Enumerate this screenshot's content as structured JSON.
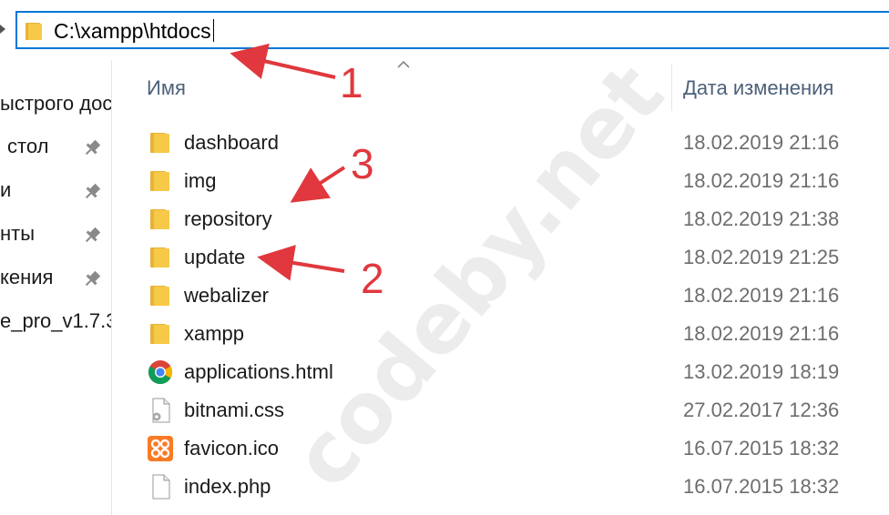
{
  "address_bar": {
    "path": "C:\\xampp\\htdocs"
  },
  "sidebar": {
    "items": [
      {
        "label": "ыстрого дос",
        "pinned": false
      },
      {
        "label": "стол",
        "pinned": true
      },
      {
        "label": "и",
        "pinned": true
      },
      {
        "label": "нты",
        "pinned": true
      },
      {
        "label": "кения",
        "pinned": true
      },
      {
        "label": "e_pro_v1.7.3",
        "pinned": false
      }
    ]
  },
  "columns": {
    "name": "Имя",
    "date_modified": "Дата изменения"
  },
  "files": [
    {
      "name": "dashboard",
      "date": "18.02.2019 21:16",
      "icon": "folder-icon"
    },
    {
      "name": "img",
      "date": "18.02.2019 21:16",
      "icon": "folder-icon"
    },
    {
      "name": "repository",
      "date": "18.02.2019 21:38",
      "icon": "folder-icon"
    },
    {
      "name": "update",
      "date": "18.02.2019 21:25",
      "icon": "folder-icon"
    },
    {
      "name": "webalizer",
      "date": "18.02.2019 21:16",
      "icon": "folder-icon"
    },
    {
      "name": "xampp",
      "date": "18.02.2019 21:16",
      "icon": "folder-icon"
    },
    {
      "name": "applications.html",
      "date": "13.02.2019 18:19",
      "icon": "chrome-icon"
    },
    {
      "name": "bitnami.css",
      "date": "27.02.2017 12:36",
      "icon": "css-file-icon"
    },
    {
      "name": "favicon.ico",
      "date": "16.07.2015 18:32",
      "icon": "xampp-icon"
    },
    {
      "name": "index.php",
      "date": "16.07.2015 18:32",
      "icon": "blank-file-icon"
    }
  ],
  "watermark": "codeby.net",
  "annotations": {
    "marker_1": "1",
    "marker_2": "2",
    "marker_3": "3",
    "color": "#e0383e"
  },
  "colors": {
    "accent": "#0078d7",
    "folder": "#f7c948",
    "header_text": "#4c607a",
    "date_text": "#6d6d6d"
  }
}
